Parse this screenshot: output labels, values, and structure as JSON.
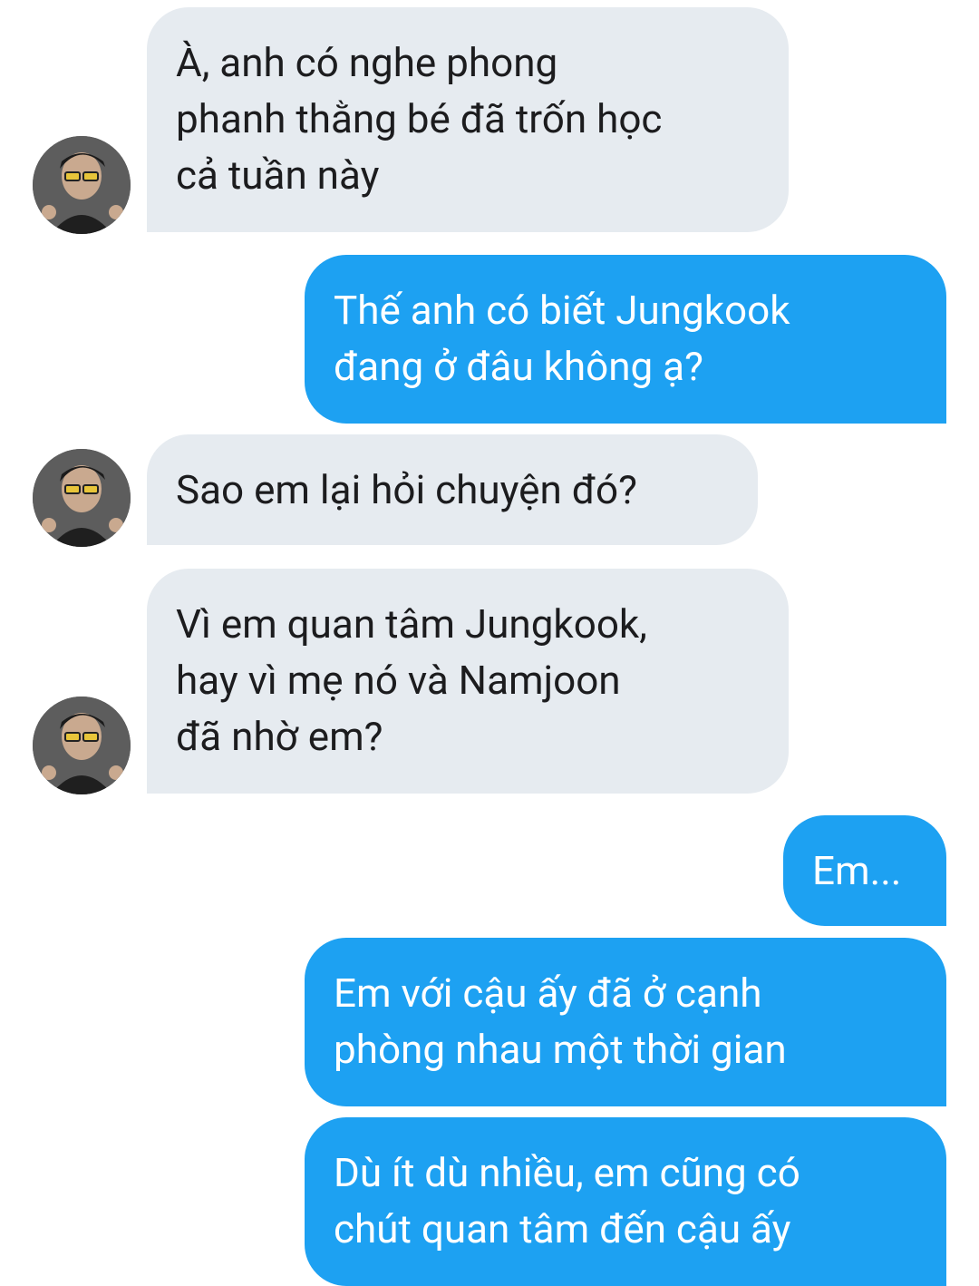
{
  "messages": [
    {
      "from": "them",
      "text": "À, anh có nghe phong\nphanh thằng bé đã trốn học\ncả tuần này"
    },
    {
      "from": "me",
      "text": "Thế anh có biết Jungkook\nđang ở đâu không ạ?"
    },
    {
      "from": "them",
      "text": "Sao em lại hỏi chuyện đó?"
    },
    {
      "from": "them",
      "text": "Vì em quan tâm Jungkook,\nhay vì mẹ nó và Namjoon\nđã nhờ em?"
    },
    {
      "from": "me",
      "text": "Em..."
    },
    {
      "from": "me",
      "text": "Em với cậu ấy đã ở cạnh\nphòng nhau một thời gian"
    },
    {
      "from": "me",
      "text": "Dù ít dù nhiều, em cũng có\nchút quan tâm đến cậu ấy"
    }
  ],
  "colors": {
    "incoming_bubble": "#e6ebf0",
    "outgoing_bubble": "#1da1f2",
    "incoming_text": "#1c1c1e",
    "outgoing_text": "#ffffff"
  },
  "icons": {
    "avatar": "avatar-photo-icon"
  }
}
